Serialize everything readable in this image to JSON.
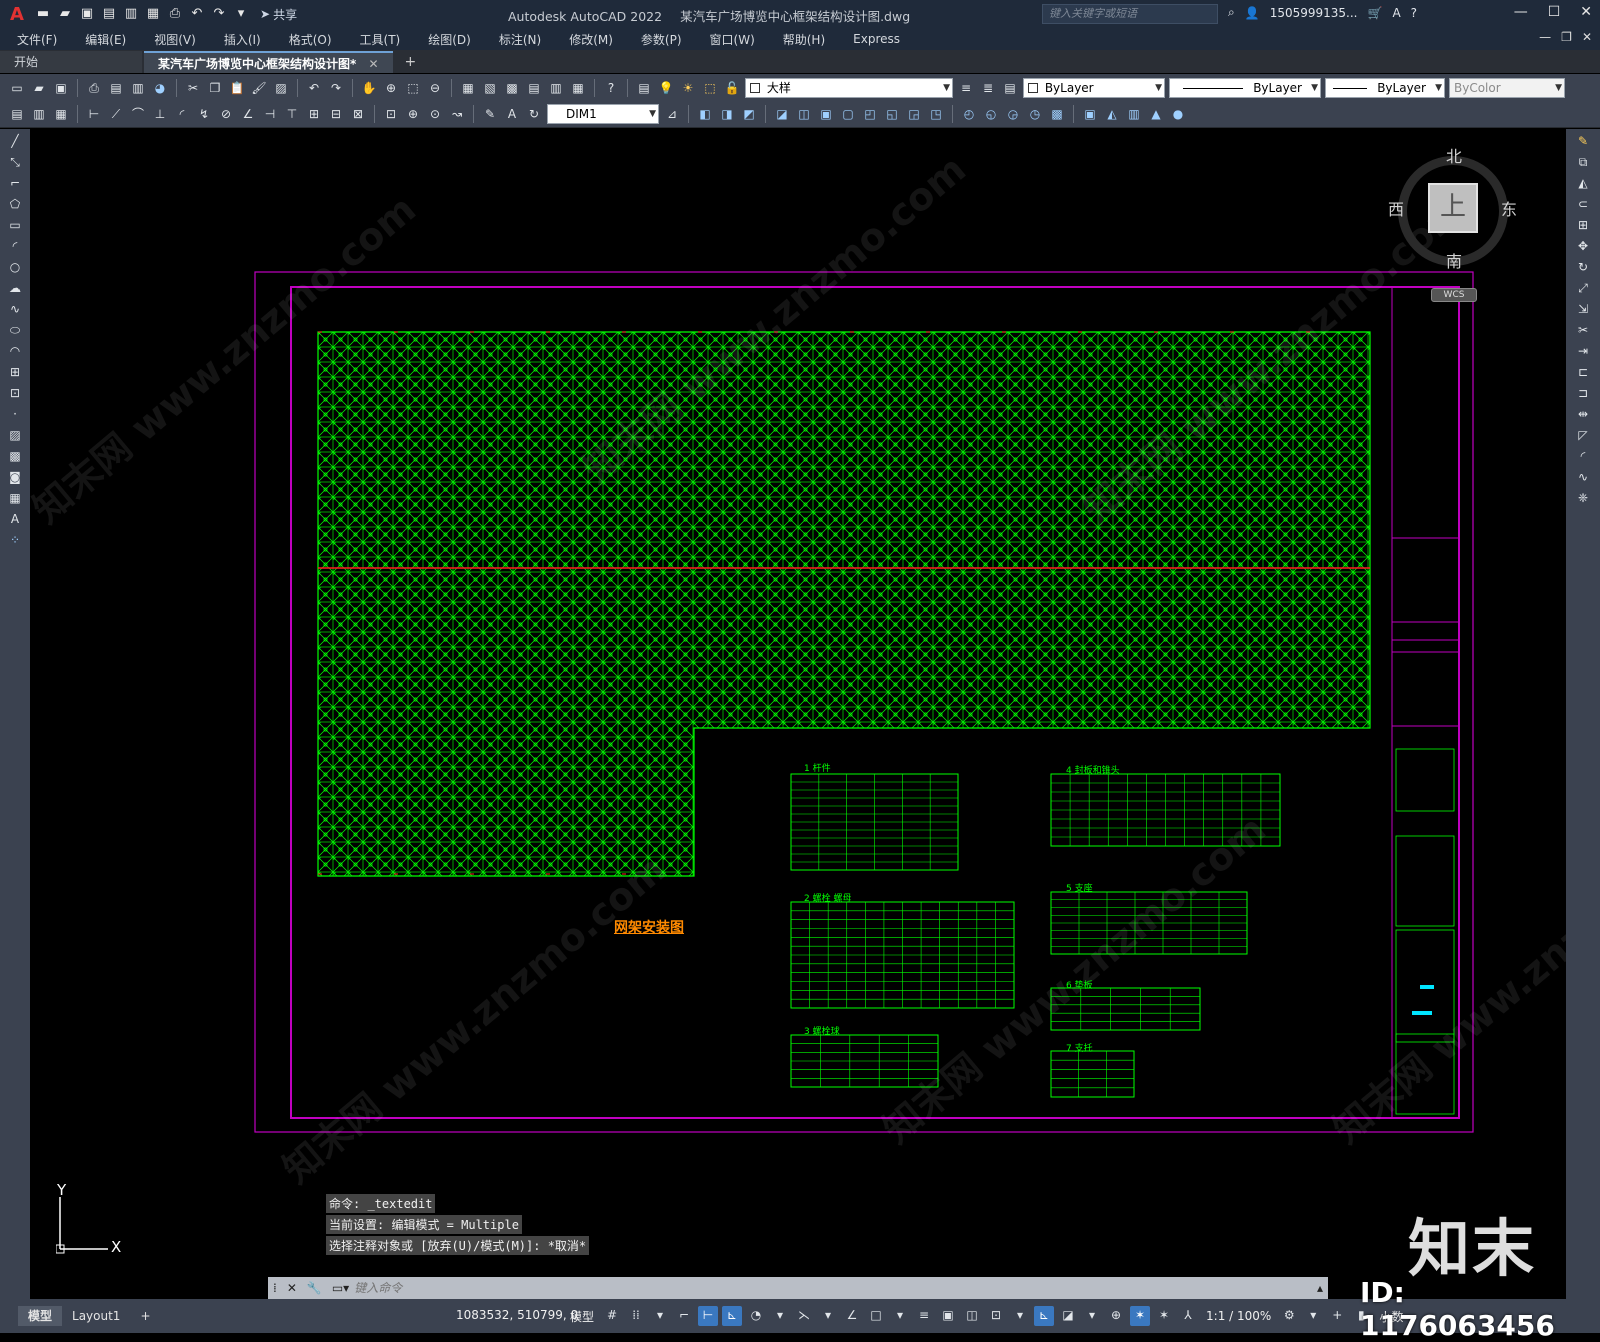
{
  "app": {
    "logo": "A",
    "title": "Autodesk AutoCAD 2022",
    "document": "某汽车广场博览中心框架结构设计图.dwg",
    "share_label": "共享",
    "search_placeholder": "键入关键字或短语",
    "user": "1505999135...",
    "window_controls": [
      "—",
      "☐",
      "✕"
    ]
  },
  "menu": [
    "文件(F)",
    "编辑(E)",
    "视图(V)",
    "插入(I)",
    "格式(O)",
    "工具(T)",
    "绘图(D)",
    "标注(N)",
    "修改(M)",
    "参数(P)",
    "窗口(W)",
    "帮助(H)",
    "Express"
  ],
  "tabs": {
    "start": "开始",
    "active": "某汽车广场博览中心框架结构设计图*",
    "close": "✕",
    "add": "+"
  },
  "toolbar": {
    "layer": "大样",
    "color": "ByLayer",
    "linetype": "ByLayer",
    "lineweight": "ByLayer",
    "plotstyle": "ByColor",
    "dimstyle": "DIM1"
  },
  "viewcube": {
    "north": "北",
    "south": "南",
    "east": "东",
    "west": "西",
    "face": "上",
    "wcs": "WCS"
  },
  "ucs": {
    "x": "X",
    "y": "Y"
  },
  "drawing": {
    "title": "网架安装图",
    "tables": [
      {
        "title": "1 杆件"
      },
      {
        "title": "2 螺栓 螺母"
      },
      {
        "title": "3 螺栓球"
      },
      {
        "title": "4 封板和锥头"
      },
      {
        "title": "5 支座"
      },
      {
        "title": "6 垫板"
      },
      {
        "title": "7 支托"
      }
    ]
  },
  "command": {
    "history": [
      "命令: _textedit",
      "当前设置: 编辑模式 = Multiple",
      "选择注释对象或 [放弃(U)/模式(M)]: *取消*"
    ],
    "placeholder": "键入命令"
  },
  "status": {
    "model_tab": "模型",
    "layout_tab": "Layout1",
    "add": "+",
    "coords": "1083532, 510799, 0",
    "model": "模型",
    "scale": "1:1 / 100%",
    "units": "小数"
  },
  "watermark": {
    "logo": "知末",
    "id": "ID: 1176063456",
    "site": "知末网 www.znzmo.com"
  },
  "colors": {
    "grid": "#00ff00",
    "border": "#c000c0",
    "red_line": "#ff2020",
    "title_orange": "#ff8a00",
    "cyan": "#00e5ff"
  }
}
